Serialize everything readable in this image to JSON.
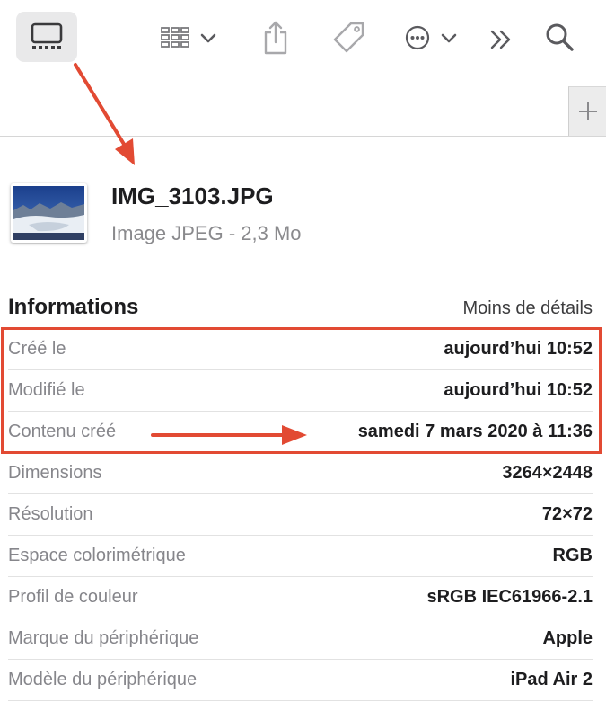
{
  "toolbar": {
    "icons": [
      "gallery-view-icon",
      "grid-view-icon",
      "chevron-down-icon",
      "share-icon",
      "tag-icon",
      "more-icon",
      "chevron-down-icon",
      "chevron-double-right-icon",
      "search-icon"
    ]
  },
  "file": {
    "name": "IMG_3103.JPG",
    "type_size": "Image JPEG - 2,3 Mo"
  },
  "info": {
    "title": "Informations",
    "less_details": "Moins de détails",
    "rows": [
      {
        "label": "Créé le",
        "value": "aujourd’hui 10:52"
      },
      {
        "label": "Modifié le",
        "value": "aujourd’hui 10:52"
      },
      {
        "label": "Contenu créé",
        "value": "samedi 7 mars 2020 à 11:36"
      },
      {
        "label": "Dimensions",
        "value": "3264×2448"
      },
      {
        "label": "Résolution",
        "value": "72×72"
      },
      {
        "label": "Espace colorimétrique",
        "value": "RGB"
      },
      {
        "label": "Profil de couleur",
        "value": "sRGB IEC61966-2.1"
      },
      {
        "label": "Marque du périphérique",
        "value": "Apple"
      },
      {
        "label": "Modèle du périphérique",
        "value": "iPad Air 2"
      }
    ]
  },
  "colors": {
    "annotation": "#e24a33",
    "label_gray": "#86868b",
    "toolbar_icon": "#7a7a7e"
  }
}
